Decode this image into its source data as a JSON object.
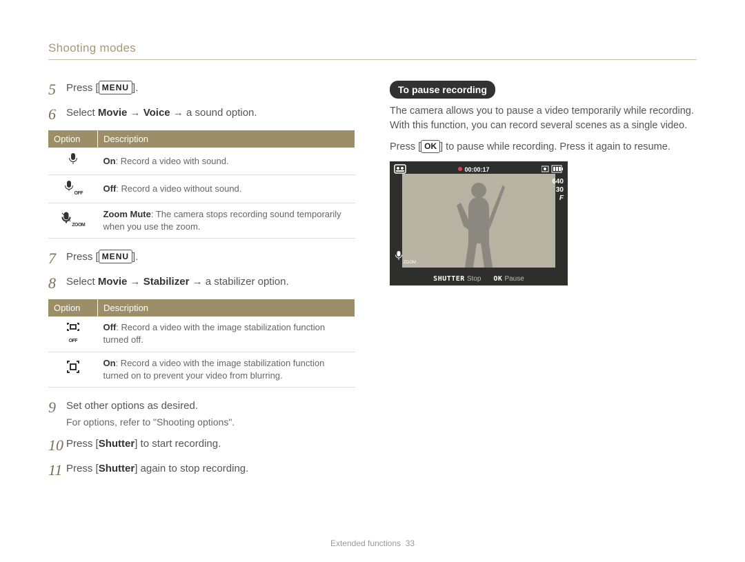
{
  "header": {
    "title": "Shooting modes"
  },
  "steps": {
    "s5": {
      "num": "5",
      "pre": "Press [",
      "btn": "MENU",
      "post": "]."
    },
    "s6": {
      "num": "6",
      "pre": "Select ",
      "b1": "Movie",
      "arrow1": " → ",
      "b2": "Voice",
      "arrow2": " → ",
      "tail": "a sound option."
    },
    "s7": {
      "num": "7",
      "pre": "Press [",
      "btn": "MENU",
      "post": "]."
    },
    "s8": {
      "num": "8",
      "pre": "Select ",
      "b1": "Movie",
      "arrow1": " → ",
      "b2": "Stabilizer",
      "arrow2": " → ",
      "tail": "a stabilizer option."
    },
    "s9": {
      "num": "9",
      "line1": "Set other options as desired.",
      "line2": "For options, refer to \"Shooting options\"."
    },
    "s10": {
      "num": "10",
      "pre": "Press [",
      "b1": "Shutter",
      "post": "] to start recording."
    },
    "s11": {
      "num": "11",
      "pre": "Press [",
      "b1": "Shutter",
      "post": "] again to stop recording."
    }
  },
  "voiceTable": {
    "header": {
      "option": "Option",
      "description": "Description"
    },
    "rows": [
      {
        "iconName": "mic-on-icon",
        "b": "On",
        "rest": ": Record a video with sound."
      },
      {
        "iconName": "mic-off-icon",
        "b": "Off",
        "rest": ": Record a video without sound."
      },
      {
        "iconName": "mic-zoom-mute-icon",
        "b": "Zoom Mute",
        "rest": ": The camera stops recording sound temporarily when you use the zoom."
      }
    ]
  },
  "stabTable": {
    "header": {
      "option": "Option",
      "description": "Description"
    },
    "rows": [
      {
        "iconName": "stabilizer-off-icon",
        "b": "Off",
        "rest": ": Record a video with the image stabilization function turned off."
      },
      {
        "iconName": "stabilizer-on-icon",
        "b": "On",
        "rest": ": Record a video with the image stabilization function turned on to prevent your video from blurring."
      }
    ]
  },
  "right": {
    "pill": "To pause recording",
    "p1": "The camera allows you to pause a video temporarily while recording. With this function, you can record several scenes as a single video.",
    "p2pre": "Press [",
    "p2btn": "OK",
    "p2post": "] to pause while recording. Press it again to resume."
  },
  "screen": {
    "timer": "00:00:17",
    "res": "640",
    "fps": "30",
    "fpsUnit": "F",
    "shutterLabel": "SHUTTER",
    "shutterAction": "Stop",
    "okLabel": "OK",
    "okAction": "Pause"
  },
  "footer": {
    "section": "Extended functions",
    "page": "33"
  }
}
